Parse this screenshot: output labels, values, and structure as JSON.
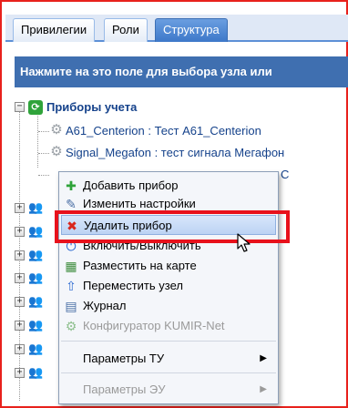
{
  "tabs": [
    {
      "label": "Привилегии",
      "active": false
    },
    {
      "label": "Роли",
      "active": false
    },
    {
      "label": "Структура",
      "active": true
    }
  ],
  "header": {
    "text": "Нажмите на это поле для выбора узла или"
  },
  "tree": {
    "root": {
      "label": "Приборы учета",
      "expander": "−"
    },
    "children": [
      {
        "label": "A61_Centerion : Тест A61_Centerion"
      },
      {
        "label": "Signal_Megafon : тест сигнала Мегафон"
      },
      {
        "label": "С"
      }
    ],
    "collapsed_expander": "+"
  },
  "context_menu": {
    "items": [
      {
        "label": "Добавить прибор",
        "icon": "plus-icon",
        "glyph": "✚",
        "color": "#2fa33a",
        "disabled": false
      },
      {
        "label": "Изменить настройки",
        "icon": "edit-doc-icon",
        "glyph": "✎",
        "color": "#4a6fa5",
        "disabled": false
      },
      {
        "label": "Удалить прибор",
        "icon": "delete-x-icon",
        "glyph": "✖",
        "color": "#d9261c",
        "disabled": false,
        "highlighted": true
      },
      {
        "label": "Включить/Выключить",
        "icon": "power-icon",
        "glyph": "⏻",
        "color": "#2d6ad1",
        "disabled": false
      },
      {
        "label": "Разместить на карте",
        "icon": "map-icon",
        "glyph": "▦",
        "color": "#3d8c3d",
        "disabled": false
      },
      {
        "label": "Переместить узел",
        "icon": "move-up-icon",
        "glyph": "⇧",
        "color": "#2d6ad1",
        "disabled": false
      },
      {
        "label": "Журнал",
        "icon": "journal-icon",
        "glyph": "▤",
        "color": "#4a6fa5",
        "disabled": false
      },
      {
        "label": "Конфигуратор KUMIR-Net",
        "icon": "config-icon",
        "glyph": "⚙",
        "color": "#8fc08f",
        "disabled": true
      },
      {
        "label": "Параметры ТУ",
        "submenu": true,
        "disabled": false
      },
      {
        "label": "Параметры ЭУ",
        "submenu": true,
        "disabled": true
      }
    ],
    "submenu_arrow": "▶"
  },
  "colors": {
    "accent": "#3f6fb0",
    "highlight_border": "#e8111b",
    "frame_border": "#e8211c"
  }
}
